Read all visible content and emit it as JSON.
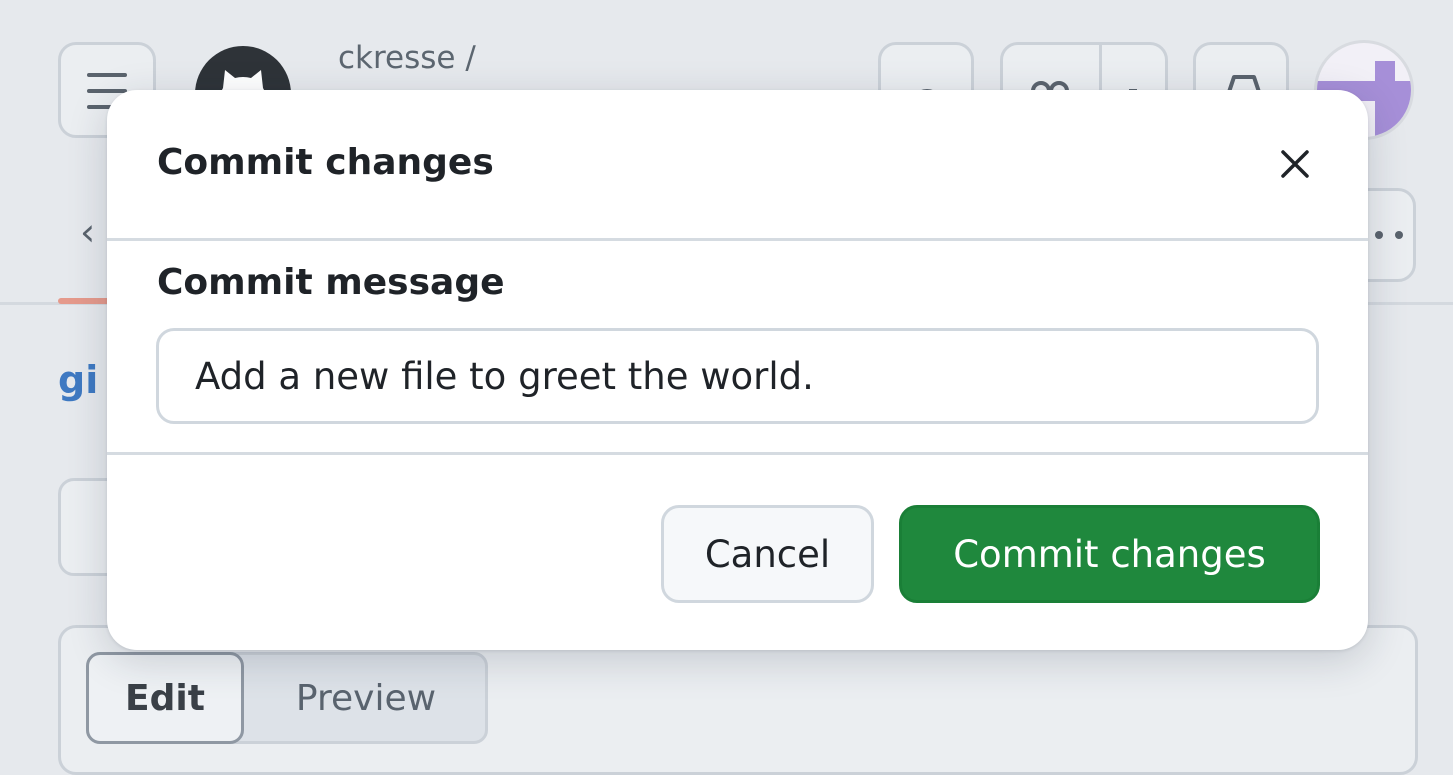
{
  "background": {
    "repo_owner": "ckresse /",
    "repo_link_fragment": "gi",
    "editor_tabs": {
      "edit_label": "Edit",
      "preview_label": "Preview"
    }
  },
  "dialog": {
    "title": "Commit changes",
    "field_label": "Commit message",
    "commit_message_value": "Add a new file to greet the world.",
    "cancel_label": "Cancel",
    "submit_label": "Commit changes"
  },
  "colors": {
    "primary_green": "#1f883d",
    "link_blue": "#3e79c2",
    "overlay_bg": "#e6e9ed"
  },
  "icons": {
    "menu": "hamburger-icon",
    "logo": "github-mark-icon",
    "search": "search-icon",
    "copilot": "copilot-icon",
    "inbox": "inbox-icon",
    "close": "close-icon",
    "back": "chevron-left-icon",
    "more": "kebab-horizontal-icon"
  }
}
